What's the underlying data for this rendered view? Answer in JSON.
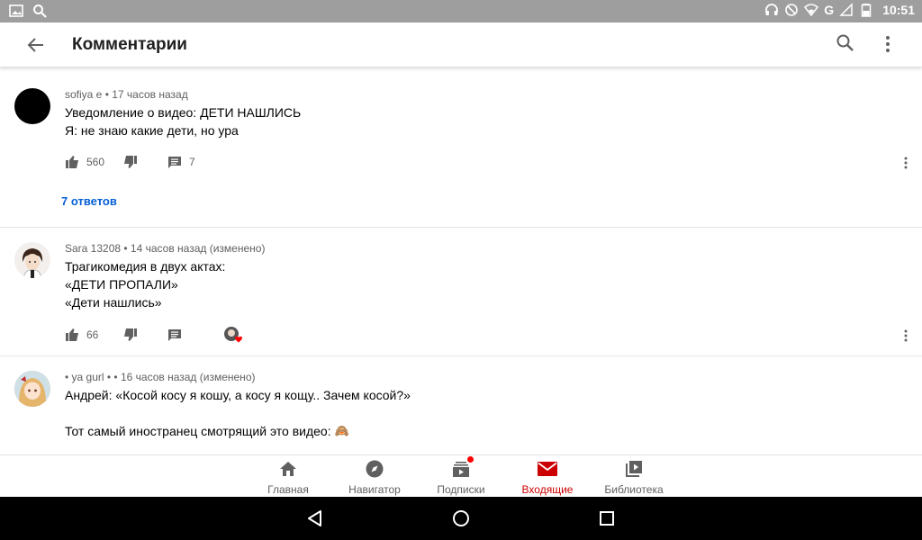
{
  "status_bar": {
    "left_icons": [
      "image-icon",
      "search-icon"
    ],
    "right_icons": [
      "headphones-icon",
      "dnd-icon",
      "wifi-icon",
      "signal-icon",
      "battery-icon"
    ],
    "network_label": "G",
    "time": "10:51"
  },
  "appbar": {
    "title": "Комментарии",
    "icons": [
      "back-arrow-icon",
      "search-icon",
      "more-vert-icon"
    ]
  },
  "comments": [
    {
      "author": "sofiya e",
      "time": "17 часов назад",
      "meta": "sofiya e • 17 часов назад",
      "lines": [
        "Уведомление о видео: ДЕТИ НАШЛИСЬ",
        "Я: не знаю какие дети, но ура"
      ],
      "likes": "560",
      "replies_count": "7",
      "replies_link": "7 ответов",
      "avatar_color": "#000000"
    },
    {
      "author": "Sara 13208",
      "meta": "Sara 13208 • 14 часов назад (изменено)",
      "lines": [
        "Трагикомедия в двух актах:",
        "«ДЕТИ ПРОПАЛИ»",
        "«Дети нашлись»"
      ],
      "likes": "66",
      "hearted": true
    },
    {
      "author": "• ya gurl •",
      "meta": "• ya gurl • • 16 часов назад (изменено)",
      "lines": [
        "Андрей: «Косой косу я кошу, а косу я кощу.. Зачем косой?»",
        "",
        "Тот самый иностранец смотрящий это видео:"
      ],
      "emoji": "🙈"
    }
  ],
  "bottom_nav": [
    {
      "label": "Главная",
      "icon": "home-icon"
    },
    {
      "label": "Навигатор",
      "icon": "compass-icon"
    },
    {
      "label": "Подписки",
      "icon": "subscriptions-icon",
      "badge": true
    },
    {
      "label": "Входящие",
      "icon": "inbox-icon",
      "active": true
    },
    {
      "label": "Библиотека",
      "icon": "library-icon"
    }
  ],
  "colors": {
    "accent_red": "#cc0000",
    "link_blue": "#065fd4",
    "status_bar": "#9e9e9e",
    "secondary_text": "#606060"
  }
}
